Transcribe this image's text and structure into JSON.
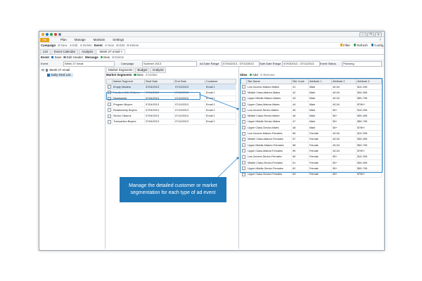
{
  "title_bar": {
    "back": "‹",
    "forward": "›",
    "window_buttons": [
      "–",
      "❐",
      "✕"
    ]
  },
  "menu": {
    "file_label": "File",
    "items": [
      "Plan",
      "Manage",
      "Maintain",
      "Settings"
    ],
    "help": "?"
  },
  "toolbar": {
    "campaign_label": "Campaign",
    "new": "New",
    "edit": "Edit",
    "delete": "Delete",
    "event_label": "Event",
    "event_new": "New",
    "event_edit": "Edit",
    "event_delete": "Delete",
    "filter": "Filter",
    "refresh": "Refresh",
    "config": "Config"
  },
  "tabs": [
    "List",
    "Event Calendar",
    "Analysis",
    "Week 27 email"
  ],
  "tab_close": "×",
  "toolbar2": {
    "event_label": "Event",
    "save": "Save",
    "edit_header": "Edit Header",
    "message_label": "Message",
    "new": "New",
    "delete": "Delete"
  },
  "event_info": {
    "event_label": "Event",
    "event_value": "Week 27 email",
    "campaign_label": "Campaign",
    "campaign_value": "Summer 2013",
    "ad_range_label": "Ad Date Range",
    "ad_range_value": "07/04/2013 - 07/10/2013",
    "sale_range_label": "Sale Date Range",
    "sale_range_value": "07/03/2013 - 07/11/2013",
    "status_label": "Event Status",
    "status_value": "Planning"
  },
  "tree": {
    "root": "Week 27 email",
    "child": "Daily Deal List"
  },
  "center": {
    "tabs": [
      "Market Segments",
      "Budget",
      "Analysis"
    ],
    "segments_label": "Market Segments",
    "new": "New",
    "delete": "Delete",
    "columns": [
      "Market Segment",
      "Start Date",
      "End Date",
      "Container"
    ],
    "rows": [
      [
        "Empty Nesters",
        "07/04/2013",
        "07/10/2013",
        "Email 1"
      ],
      [
        "Families With Children",
        "07/04/2013",
        "07/10/2013",
        "Email 1"
      ],
      [
        "Newlyweds",
        "07/04/2013",
        "07/10/2013",
        "Email 1"
      ],
      [
        "Program Buyers",
        "07/04/2013",
        "07/10/2013",
        "Email 1"
      ],
      [
        "Relationship Buyers",
        "07/04/2013",
        "07/10/2013",
        "Email 1"
      ],
      [
        "Senior Citizens",
        "07/04/2013",
        "07/10/2013",
        "Email 1"
      ],
      [
        "Transaction Buyers",
        "07/04/2013",
        "07/10/2013",
        "Email 1"
      ]
    ]
  },
  "sites": {
    "label": "Sites",
    "add": "Add",
    "remove": "Remove",
    "columns": [
      "Site Name",
      "Site Code",
      "Attribute 1",
      "Attribute 2",
      "Attribute 3"
    ],
    "rows": [
      [
        "Low Income-Mature-Males",
        "41",
        "Male",
        "40-54",
        "$10-29K"
      ],
      [
        "Middle Class-Mature-Males",
        "42",
        "Male",
        "40-54",
        "$30-49K"
      ],
      [
        "Upper Middle-Mature-Males",
        "43",
        "Male",
        "40-54",
        "$50-79K"
      ],
      [
        "Upper Class-Mature-Males",
        "44",
        "Male",
        "40-54",
        "$79K+"
      ],
      [
        "Low Income-Senior-Males",
        "45",
        "Male",
        "55+",
        "$10-29K"
      ],
      [
        "Middle Class-Senior-Males",
        "46",
        "Male",
        "55+",
        "$30-49K"
      ],
      [
        "Upper Middle-Senior-Males",
        "47",
        "Male",
        "55+",
        "$50-79K"
      ],
      [
        "Upper Class-Senior-Males",
        "48",
        "Male",
        "55+",
        "$79K+"
      ],
      [
        "Low Income-Mature-Females",
        "56",
        "Female",
        "40-54",
        "$10-29K"
      ],
      [
        "Middle Class-Mature-Females",
        "57",
        "Female",
        "40-54",
        "$30-49K"
      ],
      [
        "Upper Middle-Mature-Females",
        "58",
        "Female",
        "40-54",
        "$50-79K"
      ],
      [
        "Upper Class-Mature-Females",
        "59",
        "Female",
        "40-54",
        "$79K+"
      ],
      [
        "Low Income-Senior-Females",
        "60",
        "Female",
        "55+",
        "$10-29K"
      ],
      [
        "Middle Class-Senior-Females",
        "61",
        "Female",
        "55+",
        "$30-49K"
      ],
      [
        "Upper Middle-Senior-Females",
        "62",
        "Female",
        "55+",
        "$50-79K"
      ],
      [
        "Upper Class-Senior-Females",
        "63",
        "Female",
        "55+",
        "$79K+"
      ]
    ]
  },
  "callout": {
    "text": "Manage the detailed customer or market segmentation for each type of ad event"
  },
  "colors": {
    "accent": "#2d86c9",
    "callout_bg": "#1f77b8",
    "file_button": "#e9a21f",
    "selected_row": "#dbe9f7"
  },
  "icons": [
    "save-icon",
    "add-icon",
    "delete-icon",
    "refresh-icon",
    "filter-icon",
    "config-icon",
    "tree-expand-icon",
    "list-icon"
  ]
}
